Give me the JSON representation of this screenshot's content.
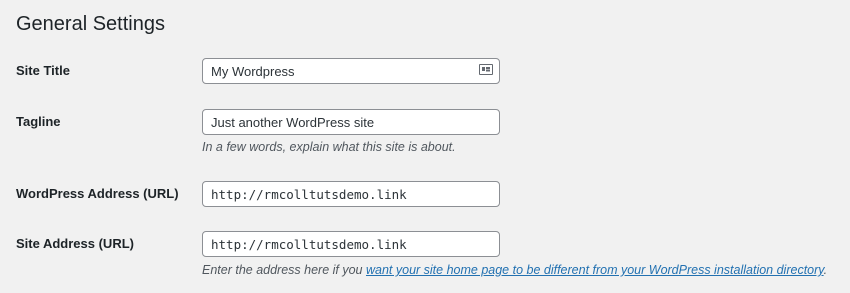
{
  "page_title": "General Settings",
  "fields": {
    "site_title": {
      "label": "Site Title",
      "value": "My Wordpress",
      "icon": "id-card-icon"
    },
    "tagline": {
      "label": "Tagline",
      "value": "Just another WordPress site",
      "description": "In a few words, explain what this site is about."
    },
    "wp_address": {
      "label": "WordPress Address (URL)",
      "value": "http://rmcolltutsdemo.link"
    },
    "site_address": {
      "label": "Site Address (URL)",
      "value": "http://rmcolltutsdemo.link",
      "description_prefix": "Enter the address here if you ",
      "description_link": "want your site home page to be different from your WordPress installation directory",
      "description_suffix": "."
    }
  },
  "colors": {
    "background": "#f1f1f1",
    "link": "#2271b1",
    "input_border": "#8c8f94"
  }
}
